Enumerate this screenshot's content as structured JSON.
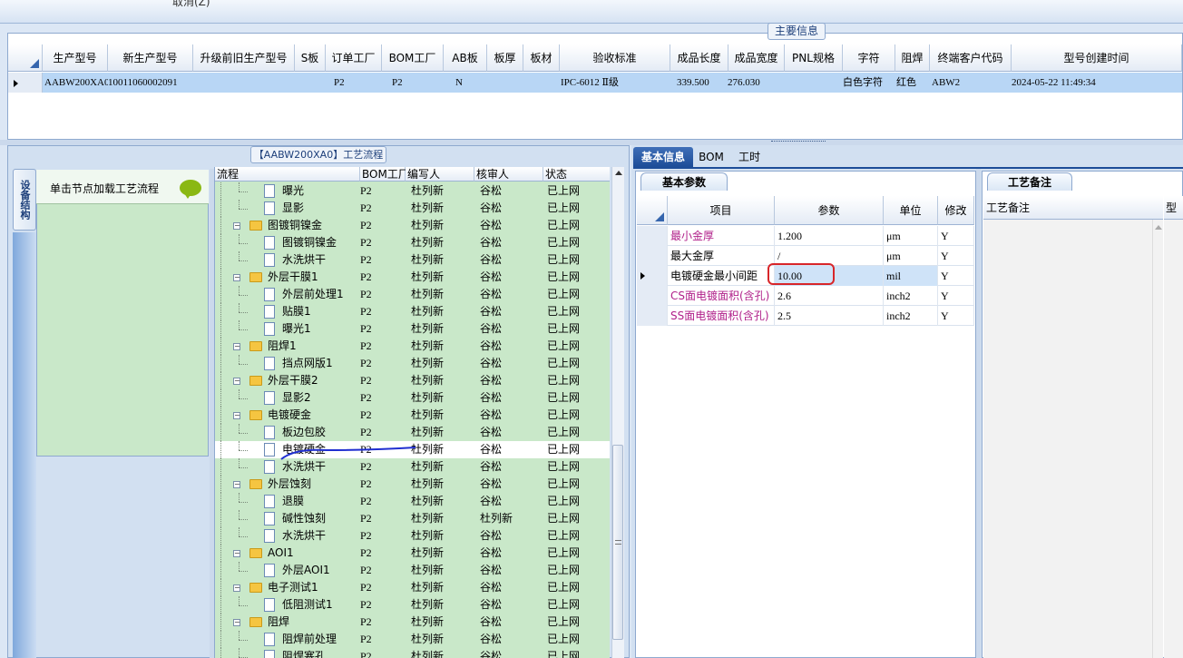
{
  "topbar": {
    "text": "取消(Z)"
  },
  "main_info": {
    "title": "主要信息",
    "columns": [
      "生产型号",
      "新生产型号",
      "升级前旧生产型号",
      "S板",
      "订单工厂",
      "BOM工厂",
      "AB板",
      "板厚",
      "板材",
      "验收标准",
      "成品长度",
      "成品宽度",
      "PNL规格",
      "字符",
      "阻焊",
      "终端客户代码",
      "型号创建时间"
    ],
    "row": {
      "production_model": "AABW200XA0",
      "new_model": "10011060002091",
      "old_model": "",
      "s_board": "",
      "order_factory": "P2",
      "bom_factory": "P2",
      "ab_board": "N",
      "thickness": "",
      "material": "",
      "standard": "IPC-6012 Ⅱ级",
      "length": "339.500",
      "width": "276.030",
      "pnl": "",
      "char": "白色字符",
      "solder": "红色",
      "customer": "ABW2",
      "created": "2024-05-22 11:49:34"
    }
  },
  "left": {
    "vertical_tab": "设备结构",
    "load_text": "单击节点加载工艺流程",
    "process_title": "【AABW200XA0】工艺流程",
    "tree_columns": [
      "流程",
      "BOM工厂",
      "编写人",
      "核审人",
      "状态"
    ],
    "tree_rows": [
      {
        "label": "曝光",
        "type": "doc",
        "level": 2,
        "bom": "P2",
        "writer": "杜列新",
        "reviewer": "谷松",
        "status": "已上网"
      },
      {
        "label": "显影",
        "type": "doc",
        "level": 2,
        "bom": "P2",
        "writer": "杜列新",
        "reviewer": "谷松",
        "status": "已上网"
      },
      {
        "label": "图镀铜镍金",
        "type": "folder",
        "level": 1,
        "bom": "P2",
        "writer": "杜列新",
        "reviewer": "谷松",
        "status": "已上网"
      },
      {
        "label": "图镀铜镍金",
        "type": "doc",
        "level": 2,
        "bom": "P2",
        "writer": "杜列新",
        "reviewer": "谷松",
        "status": "已上网"
      },
      {
        "label": "水洗烘干",
        "type": "doc",
        "level": 2,
        "bom": "P2",
        "writer": "杜列新",
        "reviewer": "谷松",
        "status": "已上网"
      },
      {
        "label": "外层干膜1",
        "type": "folder",
        "level": 1,
        "bom": "P2",
        "writer": "杜列新",
        "reviewer": "谷松",
        "status": "已上网"
      },
      {
        "label": "外层前处理1",
        "type": "doc",
        "level": 2,
        "bom": "P2",
        "writer": "杜列新",
        "reviewer": "谷松",
        "status": "已上网"
      },
      {
        "label": "贴膜1",
        "type": "doc",
        "level": 2,
        "bom": "P2",
        "writer": "杜列新",
        "reviewer": "谷松",
        "status": "已上网"
      },
      {
        "label": "曝光1",
        "type": "doc",
        "level": 2,
        "bom": "P2",
        "writer": "杜列新",
        "reviewer": "谷松",
        "status": "已上网"
      },
      {
        "label": "阻焊1",
        "type": "folder",
        "level": 1,
        "bom": "P2",
        "writer": "杜列新",
        "reviewer": "谷松",
        "status": "已上网"
      },
      {
        "label": "挡点网版1",
        "type": "doc",
        "level": 2,
        "bom": "P2",
        "writer": "杜列新",
        "reviewer": "谷松",
        "status": "已上网"
      },
      {
        "label": "外层干膜2",
        "type": "folder",
        "level": 1,
        "bom": "P2",
        "writer": "杜列新",
        "reviewer": "谷松",
        "status": "已上网"
      },
      {
        "label": "显影2",
        "type": "doc",
        "level": 2,
        "bom": "P2",
        "writer": "杜列新",
        "reviewer": "谷松",
        "status": "已上网"
      },
      {
        "label": "电镀硬金",
        "type": "folder",
        "level": 1,
        "bom": "P2",
        "writer": "杜列新",
        "reviewer": "谷松",
        "status": "已上网"
      },
      {
        "label": "板边包胶",
        "type": "doc",
        "level": 2,
        "bom": "P2",
        "writer": "杜列新",
        "reviewer": "谷松",
        "status": "已上网"
      },
      {
        "label": "电镀硬金",
        "type": "doc",
        "level": 2,
        "bom": "P2",
        "writer": "杜列新",
        "reviewer": "谷松",
        "status": "已上网",
        "selected": true
      },
      {
        "label": "水洗烘干",
        "type": "doc",
        "level": 2,
        "bom": "P2",
        "writer": "杜列新",
        "reviewer": "谷松",
        "status": "已上网"
      },
      {
        "label": "外层蚀刻",
        "type": "folder",
        "level": 1,
        "bom": "P2",
        "writer": "杜列新",
        "reviewer": "谷松",
        "status": "已上网"
      },
      {
        "label": "退膜",
        "type": "doc",
        "level": 2,
        "bom": "P2",
        "writer": "杜列新",
        "reviewer": "谷松",
        "status": "已上网"
      },
      {
        "label": "碱性蚀刻",
        "type": "doc",
        "level": 2,
        "bom": "P2",
        "writer": "杜列新",
        "reviewer": "杜列新",
        "status": "已上网"
      },
      {
        "label": "水洗烘干",
        "type": "doc",
        "level": 2,
        "bom": "P2",
        "writer": "杜列新",
        "reviewer": "谷松",
        "status": "已上网"
      },
      {
        "label": "AOI1",
        "type": "folder",
        "level": 1,
        "bom": "P2",
        "writer": "杜列新",
        "reviewer": "谷松",
        "status": "已上网"
      },
      {
        "label": "外层AOI1",
        "type": "doc",
        "level": 2,
        "bom": "P2",
        "writer": "杜列新",
        "reviewer": "谷松",
        "status": "已上网"
      },
      {
        "label": "电子测试1",
        "type": "folder",
        "level": 1,
        "bom": "P2",
        "writer": "杜列新",
        "reviewer": "谷松",
        "status": "已上网"
      },
      {
        "label": "低阻测试1",
        "type": "doc",
        "level": 2,
        "bom": "P2",
        "writer": "杜列新",
        "reviewer": "谷松",
        "status": "已上网"
      },
      {
        "label": "阻焊",
        "type": "folder",
        "level": 1,
        "bom": "P2",
        "writer": "杜列新",
        "reviewer": "谷松",
        "status": "已上网"
      },
      {
        "label": "阻焊前处理",
        "type": "doc",
        "level": 2,
        "bom": "P2",
        "writer": "杜列新",
        "reviewer": "谷松",
        "status": "已上网"
      },
      {
        "label": "阻焊塞孔",
        "type": "doc",
        "level": 2,
        "bom": "P2",
        "writer": "杜列新",
        "reviewer": "谷松",
        "status": "已上网"
      }
    ]
  },
  "right": {
    "tabs": [
      "基本信息",
      "BOM",
      "工时"
    ],
    "param_tab": "基本参数",
    "param_columns": [
      "项目",
      "参数",
      "单位",
      "修改"
    ],
    "params": [
      {
        "item": "最小金厚",
        "value": "1.200",
        "unit": "μm",
        "mod": "Y",
        "pink": true
      },
      {
        "item": "最大金厚",
        "value": "/",
        "unit": "μm",
        "mod": "Y",
        "pink": false
      },
      {
        "item": "电镀硬金最小间距",
        "value": "10.00",
        "unit": "mil",
        "mod": "Y",
        "pink": false,
        "current": true
      },
      {
        "item": "CS面电镀面积(含孔)",
        "value": "2.6",
        "unit": "inch2",
        "mod": "Y",
        "pink": true
      },
      {
        "item": "SS面电镀面积(含孔)",
        "value": "2.5",
        "unit": "inch2",
        "mod": "Y",
        "pink": true
      }
    ],
    "memo_tab": "工艺备注",
    "memo_column": "工艺备注",
    "memo_column2": "型号"
  }
}
